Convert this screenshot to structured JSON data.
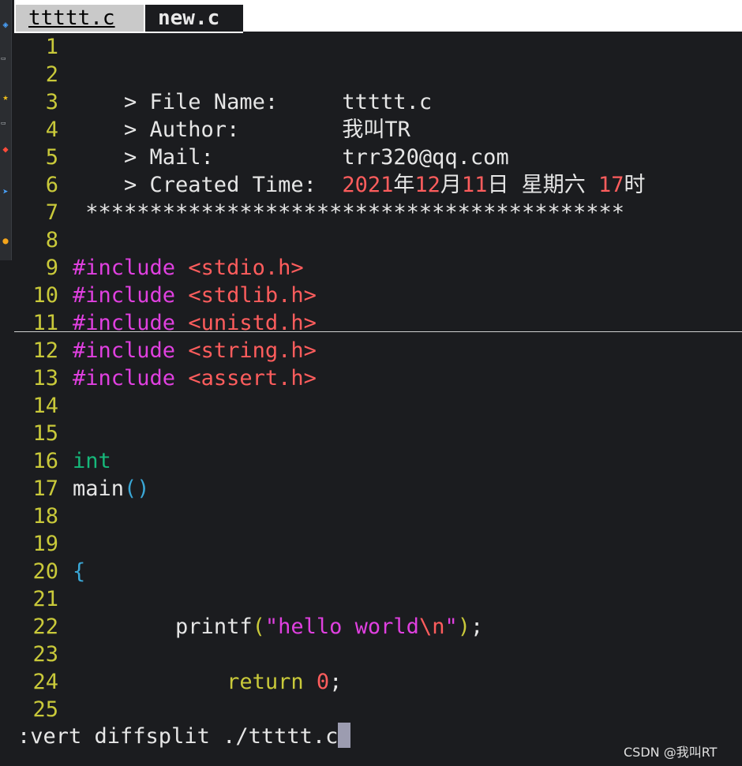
{
  "tabs": [
    {
      "label": "ttttt.c",
      "active": false
    },
    {
      "label": "new.c",
      "active": true
    }
  ],
  "lines": [
    {
      "n": "1"
    },
    {
      "n": "2"
    },
    {
      "n": "3",
      "lead": "    > File Name:     ",
      "value": "ttttt.c"
    },
    {
      "n": "4",
      "lead": "    > Author:        ",
      "value": "我叫TR"
    },
    {
      "n": "5",
      "lead": "    > Mail:          ",
      "value": "trr320@qq.com"
    },
    {
      "n": "6",
      "lead": "    > Created Time:  ",
      "y": "2021",
      "yu": "年",
      "m": "12",
      "mu": "月",
      "d": "11",
      "du": "日 星期六 ",
      "h": "17",
      "hu": "时"
    },
    {
      "n": "7",
      "text": " ******************************************"
    },
    {
      "n": "8"
    },
    {
      "n": "9",
      "pre": "#include",
      "inc": "<stdio.h>"
    },
    {
      "n": "10",
      "pre": "#include",
      "inc": "<stdlib.h>"
    },
    {
      "n": "11",
      "pre": "#include",
      "inc": "<unistd.h>"
    },
    {
      "n": "12",
      "pre": "#include",
      "inc": "<string.h>"
    },
    {
      "n": "13",
      "pre": "#include",
      "inc": "<assert.h>"
    },
    {
      "n": "14"
    },
    {
      "n": "15"
    },
    {
      "n": "16",
      "type": "int"
    },
    {
      "n": "17",
      "fn": "main",
      "parens": "()"
    },
    {
      "n": "18"
    },
    {
      "n": "19"
    },
    {
      "n": "20",
      "brace": "{"
    },
    {
      "n": "21"
    },
    {
      "n": "22",
      "indent": "        ",
      "fn": "printf",
      "open": "(",
      "str": "\"hello world",
      "esc": "\\n",
      "strend": "\"",
      "close": ")",
      "semi": ";"
    },
    {
      "n": "23"
    },
    {
      "n": "24",
      "indent": "            ",
      "kw": "return",
      "sp": " ",
      "num": "0",
      "semi": ";"
    },
    {
      "n": "25"
    }
  ],
  "cmdline": ":vert diffsplit ./ttttt.c",
  "watermark": "CSDN @我叫RT"
}
